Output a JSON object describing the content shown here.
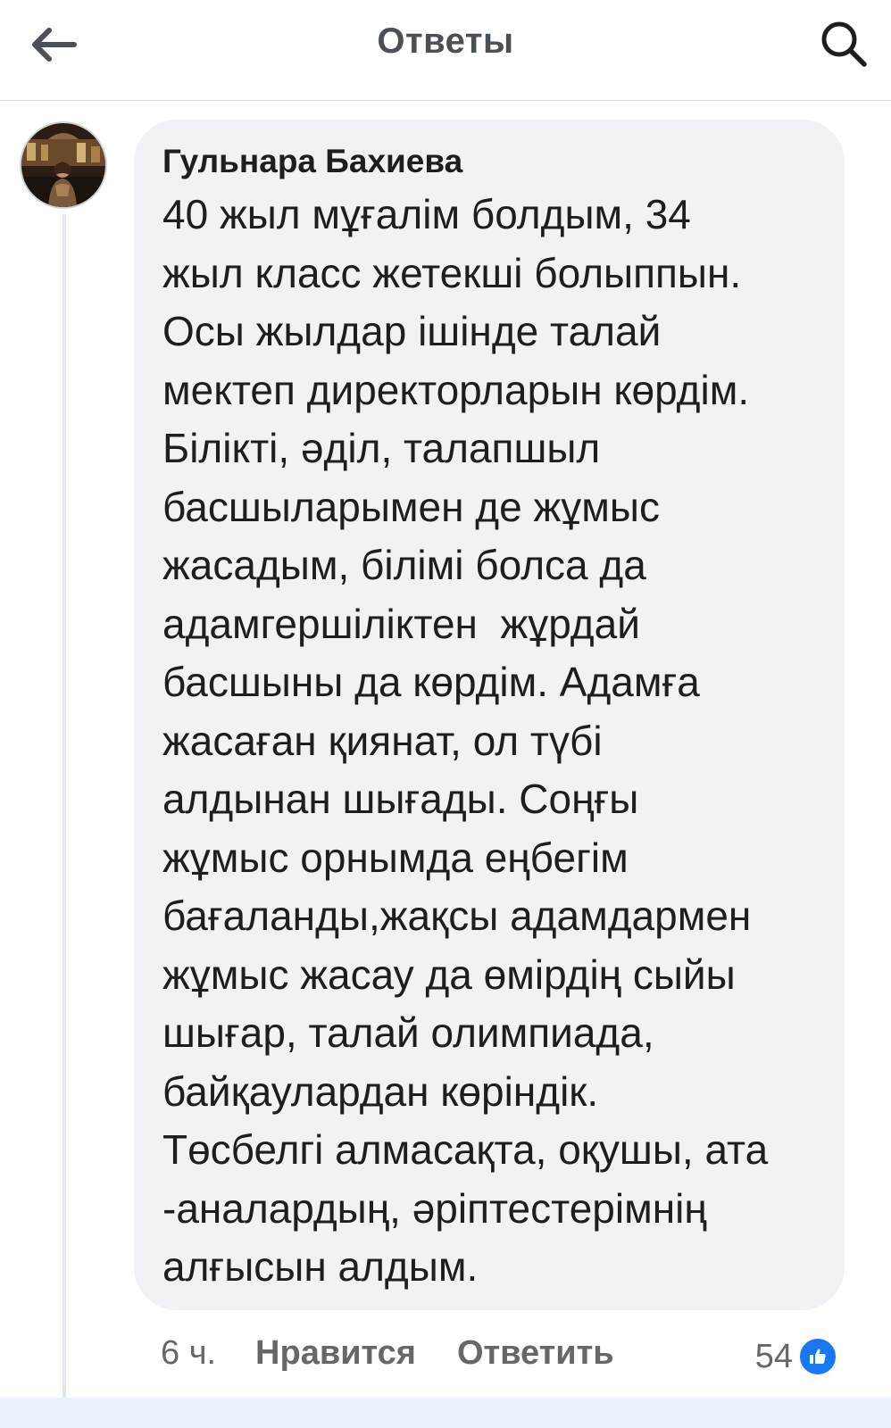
{
  "header": {
    "title": "Ответы",
    "back_icon": "arrow-left-icon",
    "search_icon": "search-icon"
  },
  "comment": {
    "author": "Гульнара Бахиева",
    "lines": [
      "40 жыл мұғалім болдым, 34",
      "жыл класс жетекші болыппын.",
      "Осы жылдар ішінде талай",
      "мектеп директорларын көрдім.",
      "Білікті, әділ, талапшыл",
      "басшыларымен де жұмыс",
      "жасадым, білімі болса да",
      "адамгершіліктен  жұрдай",
      "басшыны да көрдім. Адамға",
      "жасаған қиянат, ол түбі",
      "алдынан шығады. Соңғы",
      "жұмыс орнымда еңбегім",
      "бағаланды,жақсы адамдармен",
      "жұмыс жасау да өмірдің сыйы",
      "шығар, талай олимпиада,",
      "байқаулардан көріндік.",
      "Төсбелгі алмасақта, оқушы, ата",
      "-аналардың, әріптестерімнің",
      "алғысын алдым."
    ],
    "time": "6 ч.",
    "like_label": "Нравится",
    "reply_label": "Ответить",
    "reaction_count": "54",
    "reaction_icon": "like-thumb-icon"
  },
  "colors": {
    "bubble_bg": "#f0f2f5",
    "meta_text": "#65676b",
    "like_blue": "#1877f2"
  }
}
